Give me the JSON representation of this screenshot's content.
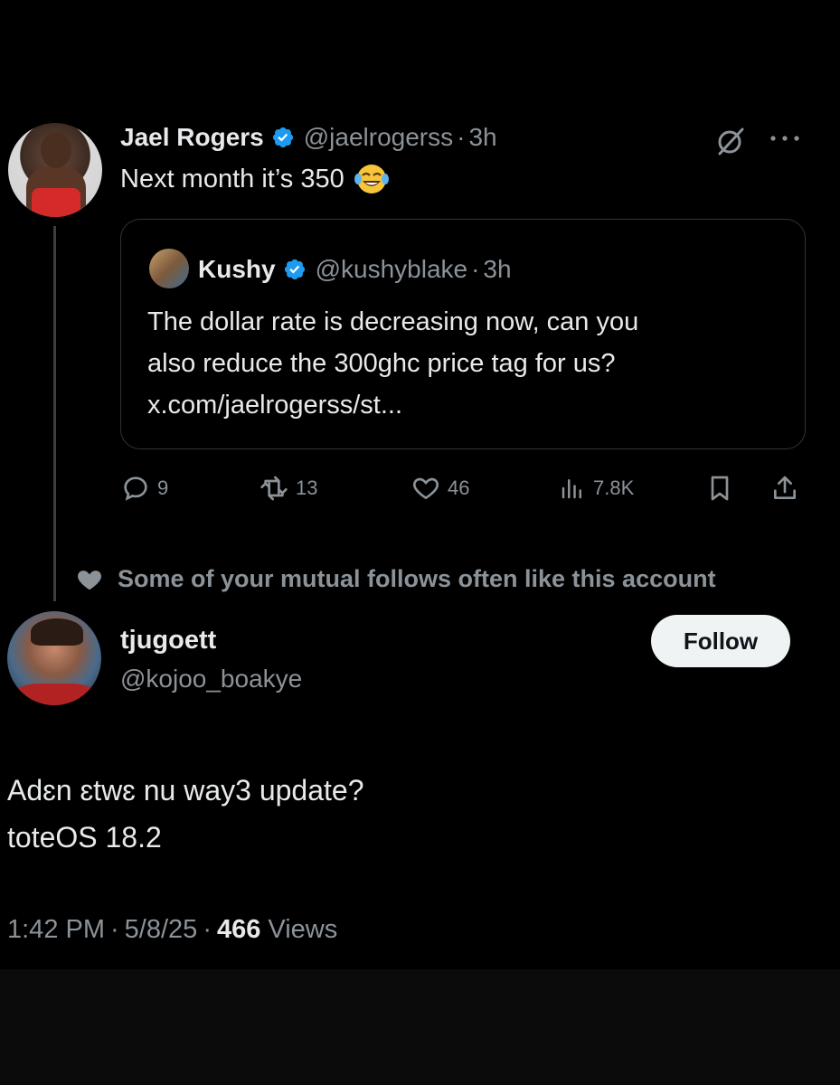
{
  "colors": {
    "background": "#000000",
    "text_primary": "#e7e9ea",
    "text_secondary": "#8b9298",
    "verified_blue": "#1d9bf0",
    "border": "#2f3336",
    "button_bg": "#eff3f4"
  },
  "tweet": {
    "author_name": "Jael Rogers",
    "author_handle": "@jaelrogerss",
    "separator": "·",
    "time": "3h",
    "text": "Next month it’s 350",
    "emoji": "face-with-tears-of-joy",
    "icons": [
      "grok-icon",
      "more-icon",
      "verified-badge-icon"
    ],
    "quoted": {
      "author_name": "Kushy",
      "author_handle": "@kushyblake",
      "separator": "·",
      "time": "3h",
      "lines": [
        "The dollar rate is decreasing now, can you",
        "also reduce the 300ghc price tag for us?",
        "x.com/jaelrogerss/st..."
      ]
    },
    "actions": {
      "replies": "9",
      "reposts": "13",
      "likes": "46",
      "views": "7.8K"
    }
  },
  "social_context": {
    "text": "Some of your mutual follows often like this account"
  },
  "reply": {
    "author_name": "tjugoett",
    "author_handle": "@kojoo_boakye",
    "follow_label": "Follow",
    "lines": [
      "Adɛn ɛtwɛ nu way3 update?",
      "toteOS 18.2"
    ],
    "time": "1:42 PM",
    "separator": "·",
    "date": "5/8/25",
    "views_count": "466",
    "views_label": "Views"
  }
}
